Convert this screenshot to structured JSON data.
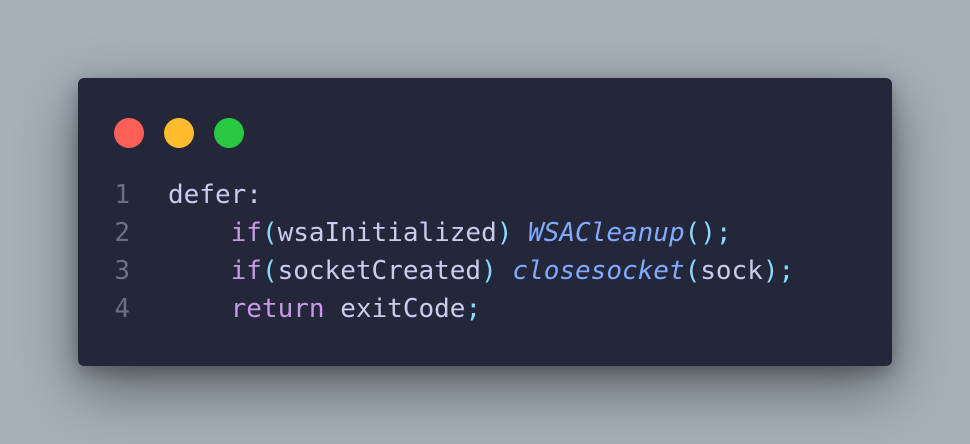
{
  "window": {
    "controls": [
      "close",
      "minimize",
      "maximize"
    ],
    "colors": {
      "close": "#ff5f57",
      "minimize": "#febc2e",
      "maximize": "#28c840",
      "background": "#242739"
    }
  },
  "code": {
    "lines": [
      {
        "number": "1",
        "tokens": [
          {
            "text": "defer:",
            "type": "id"
          }
        ]
      },
      {
        "number": "2",
        "tokens": [
          {
            "text": "    ",
            "type": "id"
          },
          {
            "text": "if",
            "type": "kw"
          },
          {
            "text": "(",
            "type": "pn"
          },
          {
            "text": "wsaInitialized",
            "type": "id"
          },
          {
            "text": ")",
            "type": "pn"
          },
          {
            "text": " ",
            "type": "id"
          },
          {
            "text": "WSACleanup",
            "type": "fn"
          },
          {
            "text": "();",
            "type": "pn"
          }
        ]
      },
      {
        "number": "3",
        "tokens": [
          {
            "text": "    ",
            "type": "id"
          },
          {
            "text": "if",
            "type": "kw"
          },
          {
            "text": "(",
            "type": "pn"
          },
          {
            "text": "socketCreated",
            "type": "id"
          },
          {
            "text": ")",
            "type": "pn"
          },
          {
            "text": " ",
            "type": "id"
          },
          {
            "text": "closesocket",
            "type": "fn"
          },
          {
            "text": "(",
            "type": "pn"
          },
          {
            "text": "sock",
            "type": "id"
          },
          {
            "text": ");",
            "type": "pn"
          }
        ]
      },
      {
        "number": "4",
        "tokens": [
          {
            "text": "    ",
            "type": "id"
          },
          {
            "text": "return",
            "type": "kw"
          },
          {
            "text": " exitCode",
            "type": "id"
          },
          {
            "text": ";",
            "type": "pn"
          }
        ]
      }
    ]
  }
}
